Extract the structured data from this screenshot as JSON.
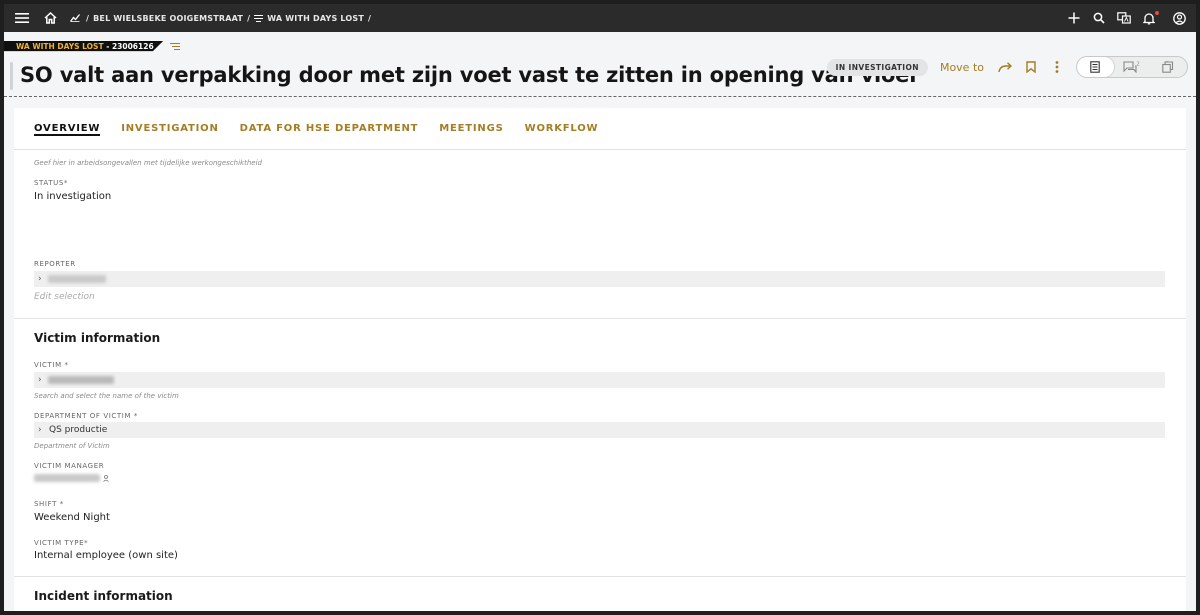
{
  "topbar": {
    "menu_icon": "hamburger-icon",
    "home_icon": "home-icon",
    "breadcrumb": [
      {
        "icon": "chart-icon",
        "label": "BEL WIELSBEKE OOIGEMSTRAAT"
      },
      {
        "icon": "lines-icon",
        "label": "WA WITH DAYS LOST"
      }
    ],
    "separator": "/",
    "right_icons": [
      "plus-icon",
      "search-icon",
      "translate-icon",
      "bell-icon",
      "user-icon"
    ]
  },
  "header": {
    "tag_type": "WA WITH DAYS LOST",
    "tag_separator": " - ",
    "tag_id": "23006126",
    "title": "SO valt aan verpakking door met zijn voet vast te zitten in opening van vloer",
    "status": "IN INVESTIGATION",
    "move_to": "Move to"
  },
  "tabs": [
    {
      "label": "OVERVIEW",
      "active": true
    },
    {
      "label": "INVESTIGATION",
      "active": false
    },
    {
      "label": "DATA FOR HSE DEPARTMENT",
      "active": false
    },
    {
      "label": "MEETINGS",
      "active": false
    },
    {
      "label": "WORKFLOW",
      "active": false
    }
  ],
  "form": {
    "intro_hint": "Geef hier in arbeidsongevallen met tijdelijke werkongeschiktheid",
    "status_label": "STATUS*",
    "status_value": "In investigation",
    "reporter_label": "REPORTER",
    "edit_selection": "Edit selection",
    "victim_section": "Victim information",
    "victim_label": "VICTIM *",
    "victim_hint": "Search and select the name of the victim",
    "department_label": "DEPARTMENT OF VICTIM *",
    "department_value": "QS productie",
    "department_hint": "Department of Victim",
    "manager_label": "VICTIM MANAGER",
    "shift_label": "SHIFT *",
    "shift_value": "Weekend Night",
    "victim_type_label": "VICTIM TYPE*",
    "victim_type_value": "Internal employee (own site)",
    "incident_section": "Incident information"
  },
  "colors": {
    "accent": "#a57d22",
    "topbar": "#2b2b2b",
    "tag_yellow": "#f0b429"
  }
}
